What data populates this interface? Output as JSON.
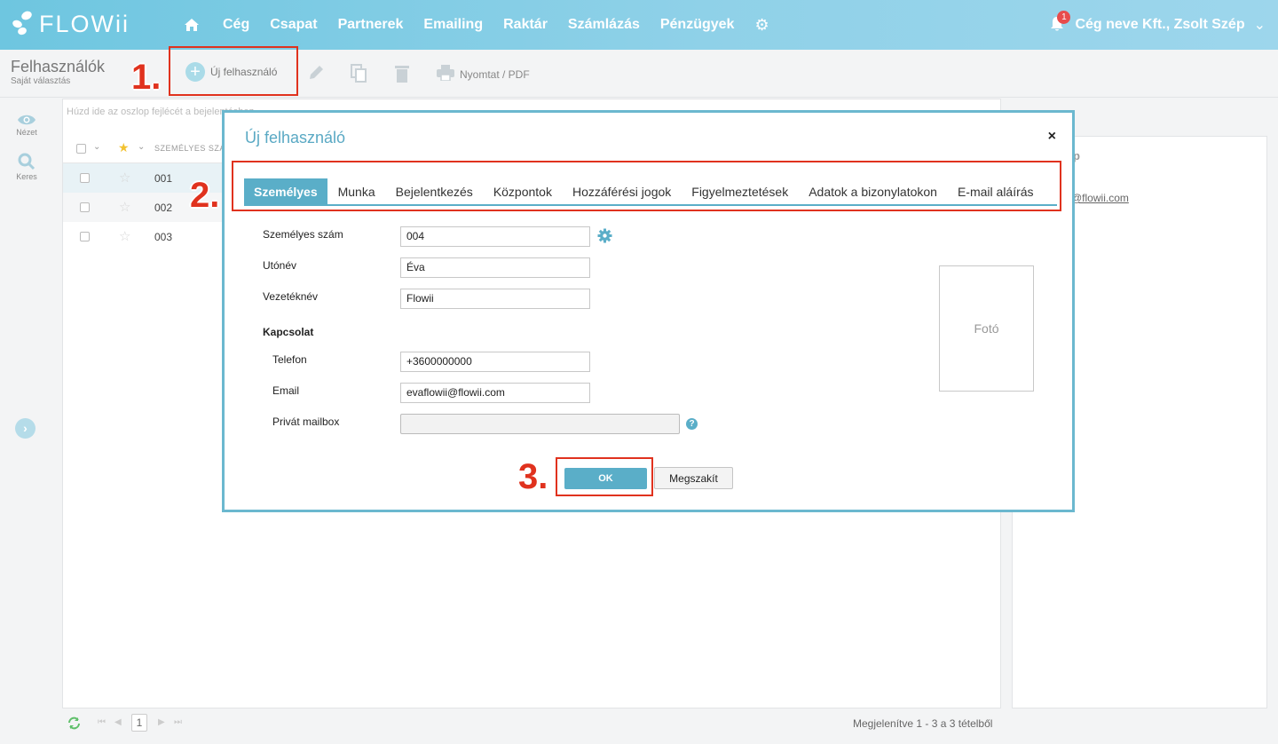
{
  "app": {
    "logo_text": "FLOWii"
  },
  "nav": {
    "items": [
      "Cég",
      "Csapat",
      "Partnerek",
      "Emailing",
      "Raktár",
      "Számlázás",
      "Pénzügyek"
    ],
    "notification_count": "1",
    "user_label": "Cég neve Kft., Zsolt Szép"
  },
  "toolbar": {
    "page_title": "Felhasználók",
    "page_subtitle": "Saját választás",
    "new_user": "Új felhasználó",
    "print": "Nyomtat / PDF"
  },
  "sidebar": {
    "view": "Nézet",
    "search": "Keres"
  },
  "grid": {
    "drag_hint": "Húzd ide az oszlop fejlécét a bejelentéshez",
    "col_header": "SZEMÉLYES SZÁ",
    "rows": [
      "001",
      "002",
      "003"
    ]
  },
  "detail": {
    "fragment_top": "p",
    "email_fragment": "@flowii.com"
  },
  "footer": {
    "page": "1",
    "summary": "Megjelenítve 1 - 3 a 3 tételből"
  },
  "annotations": {
    "n1": "1.",
    "n2": "2.",
    "n3": "3."
  },
  "modal": {
    "title": "Új felhasználó",
    "close": "×",
    "tabs": [
      "Személyes",
      "Munka",
      "Bejelentkezés",
      "Központok",
      "Hozzáférési jogok",
      "Figyelmeztetések",
      "Adatok a bizonylatokon",
      "E-mail aláírás"
    ],
    "active_tab": "Személyes",
    "fields": {
      "personal_number_label": "Személyes szám",
      "personal_number": "004",
      "first_name_label": "Utónév",
      "first_name": "Éva",
      "last_name_label": "Vezetéknév",
      "last_name": "Flowii",
      "contact_heading": "Kapcsolat",
      "phone_label": "Telefon",
      "phone": "+3600000000",
      "email_label": "Email",
      "email": "evaflowii@flowii.com",
      "private_mailbox_label": "Privát mailbox",
      "private_mailbox": ""
    },
    "photo_label": "Fotó",
    "ok": "OK",
    "cancel": "Megszakít"
  },
  "colors": {
    "accent": "#5aaec8",
    "annotation": "#e0321e"
  }
}
